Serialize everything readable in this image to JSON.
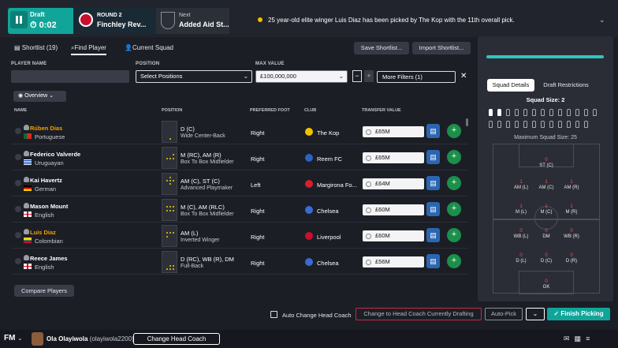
{
  "header": {
    "draft_label": "Draft",
    "timer": "0:02",
    "round_label": "ROUND 2",
    "round_team": "Finchley Rev...",
    "next_label": "Next",
    "next_team": "Added Aid St...",
    "news": "25 year-old elite winger Luis Diaz has been picked by The Kop with the 11th overall pick."
  },
  "tabs": {
    "shortlist": "Shortlist (19)",
    "find_player": "Find Player",
    "current_squad": "Current Squad",
    "save_shortlist": "Save Shortlist...",
    "import_shortlist": "Import Shortlist..."
  },
  "filters": {
    "player_name_label": "PLAYER NAME",
    "position_label": "POSITION",
    "max_value_label": "MAX VALUE",
    "position_value": "Select Positions",
    "max_value": "£100,000,000",
    "more_filters": "More Filters (1)",
    "overview": "Overview"
  },
  "columns": {
    "name": "NAME",
    "position": "POSITION",
    "foot": "PREFERRED FOOT",
    "club": "CLUB",
    "value": "TRANSFER VALUE"
  },
  "players": [
    {
      "name": "Rúben Dias",
      "nationality": "Portuguese",
      "position": "D (C)",
      "role": "Wide Center-Back",
      "foot": "Right",
      "club": "The Kop",
      "value": "£65M",
      "picked": true
    },
    {
      "name": "Federico Valverde",
      "nationality": "Uruguayan",
      "position": "M (RC), AM (R)",
      "role": "Box To Box Midfielder",
      "foot": "Right",
      "club": "Reem FC",
      "value": "£65M",
      "picked": false
    },
    {
      "name": "Kai Havertz",
      "nationality": "German",
      "position": "AM (C), ST (C)",
      "role": "Advanced Playmaker",
      "foot": "Left",
      "club": "Margirona Fo...",
      "value": "£64M",
      "picked": false
    },
    {
      "name": "Mason Mount",
      "nationality": "English",
      "position": "M (C), AM (RLC)",
      "role": "Box To Box Midfielder",
      "foot": "Right",
      "club": "Chelsea",
      "value": "£60M",
      "picked": false
    },
    {
      "name": "Luis Diaz",
      "nationality": "Colombian",
      "position": "AM (L)",
      "role": "Inverted Winger",
      "foot": "Right",
      "club": "Liverpool",
      "value": "£60M",
      "picked": true
    },
    {
      "name": "Reece James",
      "nationality": "English",
      "position": "D (RC), WB (R), DM",
      "role": "Full-Back",
      "foot": "Right",
      "club": "Chelsea",
      "value": "£56M",
      "picked": false
    }
  ],
  "compare_players": "Compare Players",
  "squad": {
    "tab_details": "Squad Details",
    "tab_restrictions": "Draft Restrictions",
    "size": "Squad Size: 2",
    "max_size": "Maximum Squad Size: 25",
    "slots": [
      {
        "label": "ST (C)",
        "count": "0"
      },
      {
        "label": "AM (L)",
        "count": "1"
      },
      {
        "label": "AM (C)",
        "count": "1"
      },
      {
        "label": "AM (R)",
        "count": "1"
      },
      {
        "label": "M (L)",
        "count": "1"
      },
      {
        "label": "M (C)",
        "count": "1"
      },
      {
        "label": "M (R)",
        "count": "1"
      },
      {
        "label": "WB (L)",
        "count": "0"
      },
      {
        "label": "DM",
        "count": "0"
      },
      {
        "label": "WB (R)",
        "count": "0"
      },
      {
        "label": "D (L)",
        "count": "0"
      },
      {
        "label": "D (C)",
        "count": "0"
      },
      {
        "label": "D (R)",
        "count": "0"
      },
      {
        "label": "GK",
        "count": "0"
      }
    ]
  },
  "actions": {
    "auto_change": "Auto Change Head Coach",
    "change_head": "Change to Head Coach Currently Drafting",
    "auto_pick": "Auto-Pick",
    "finish": "Finish Picking"
  },
  "footer": {
    "logo": "FM",
    "manager": "Ola Olayiwola",
    "handle": "(olayiwola2200)",
    "change_coach": "Change Head Coach"
  },
  "colors": {
    "accent": "#11a59a",
    "picked": "#f0a000",
    "danger": "#c62a48"
  }
}
